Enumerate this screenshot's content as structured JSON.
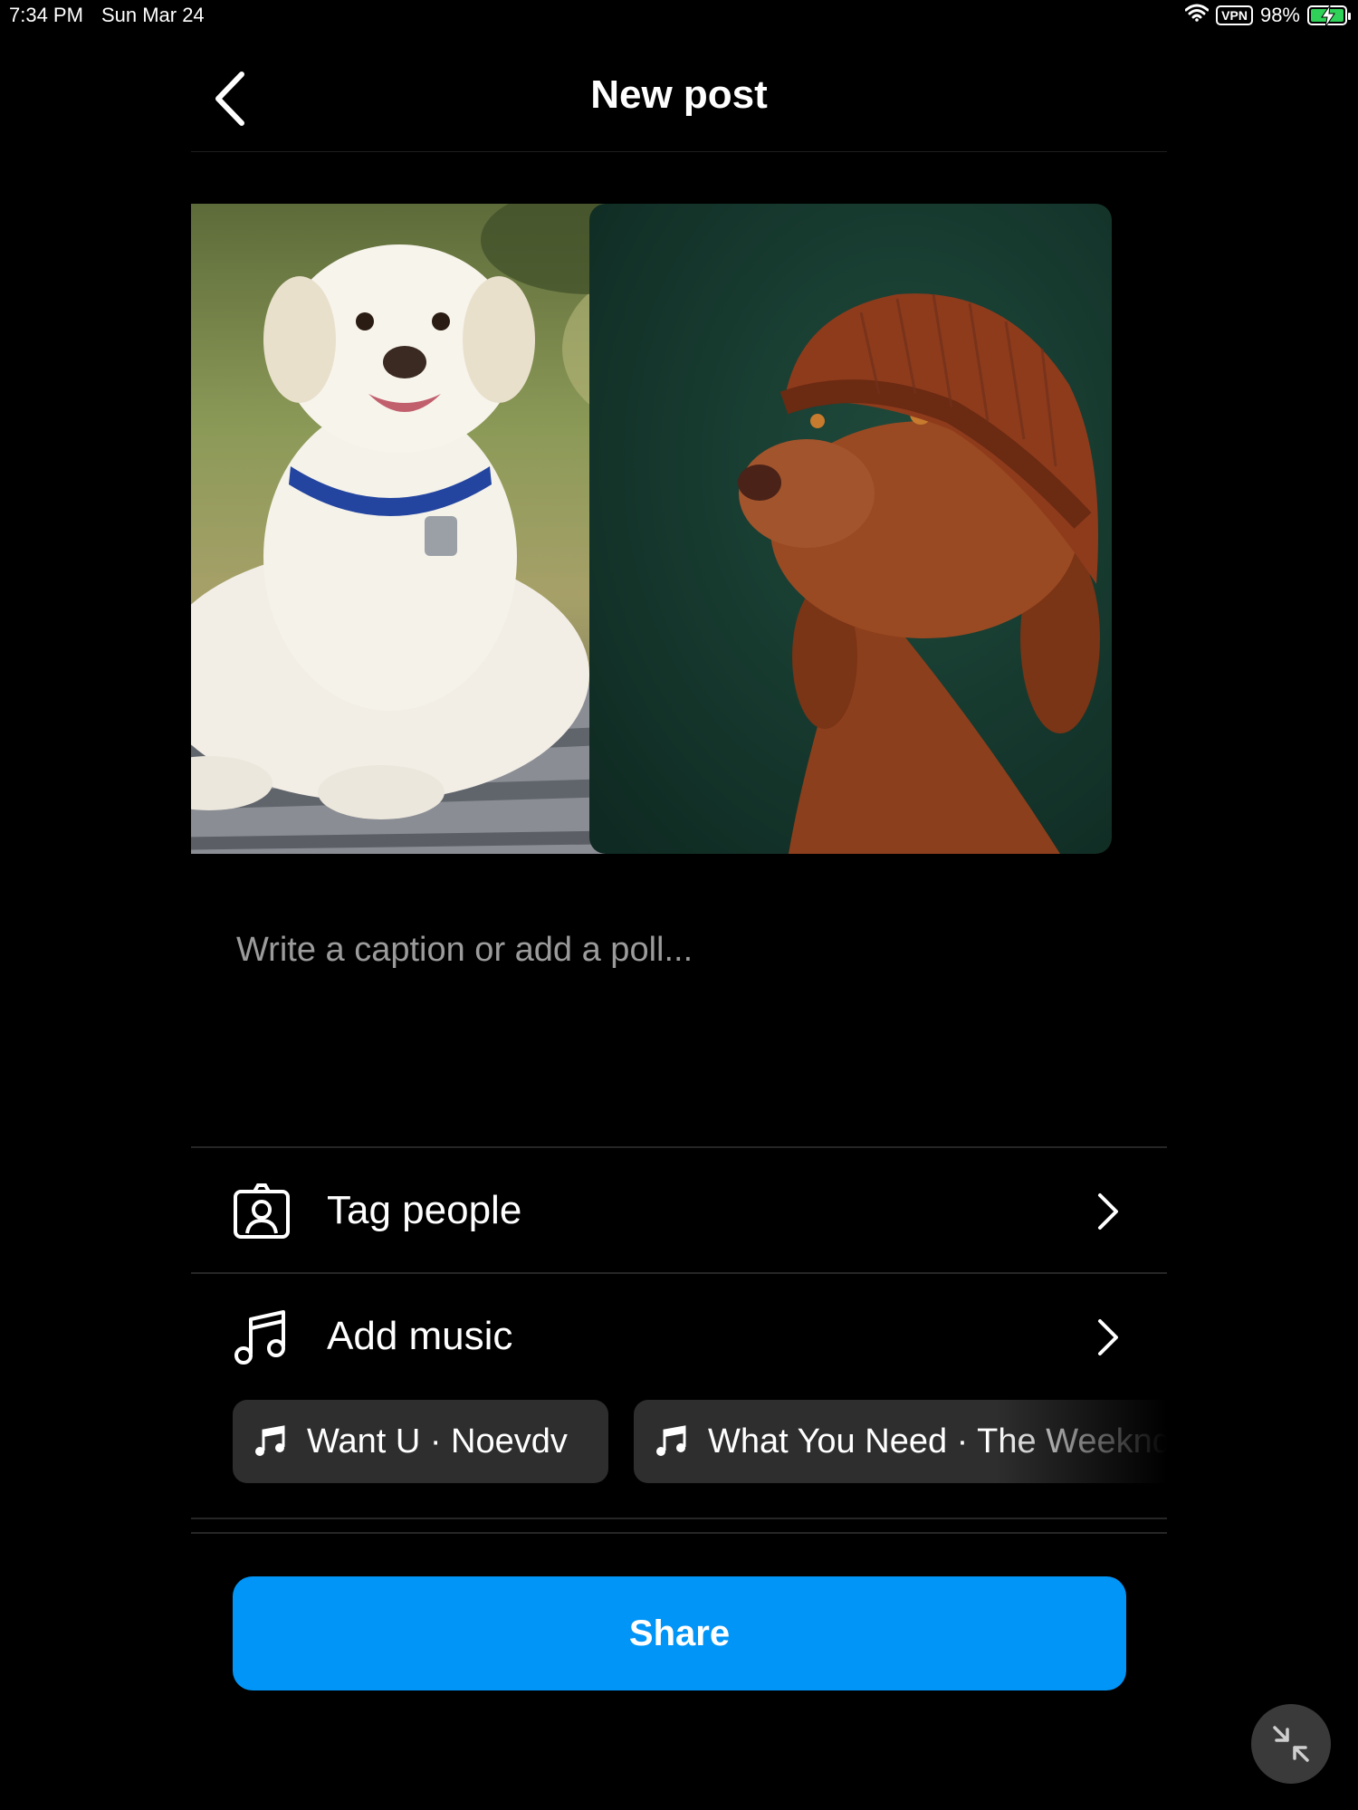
{
  "status_bar": {
    "time": "7:34 PM",
    "date": "Sun Mar 24",
    "vpn": "VPN",
    "battery": "98%",
    "battery_level": 0.98,
    "icons": [
      "wifi-icon",
      "battery-charging-icon"
    ]
  },
  "header": {
    "title": "New post",
    "back_icon": "chevron-left-icon"
  },
  "media": [
    {
      "subject": "white labrador lying on wooden planks"
    },
    {
      "subject": "brown dog wearing knit beanie on green background"
    }
  ],
  "caption": {
    "placeholder": "Write a caption or add a poll...",
    "value": ""
  },
  "options": {
    "tag_people": {
      "label": "Tag people",
      "icon": "tag-person-icon"
    },
    "add_music": {
      "label": "Add music",
      "icon": "music-note-icon"
    }
  },
  "music_suggestions": [
    {
      "label": "Want U · Noevdv"
    },
    {
      "label": "What You Need · The Weeknd"
    }
  ],
  "share": {
    "label": "Share"
  },
  "colors": {
    "background": "#000000",
    "accent": "#0095f6",
    "chip": "#2e2e2e",
    "divider": "#262626",
    "placeholder": "#9b9b9b"
  }
}
